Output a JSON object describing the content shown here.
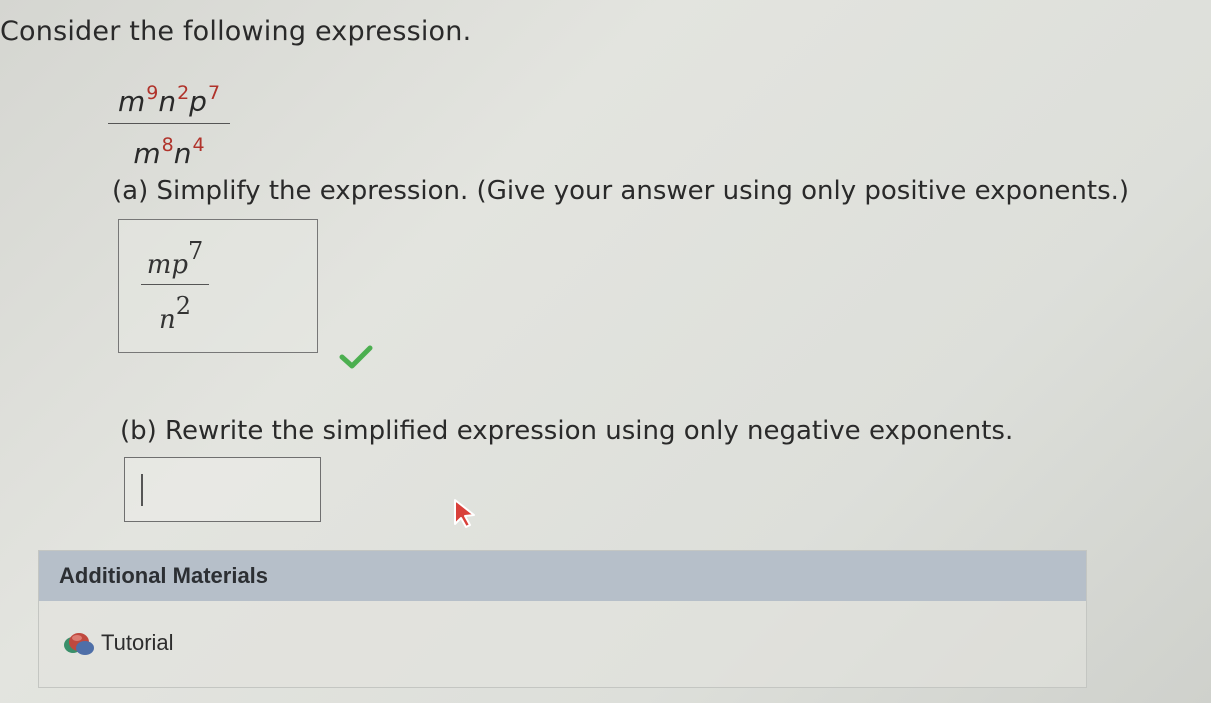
{
  "question": {
    "prompt": "Consider the following expression.",
    "expression": {
      "numerator": [
        {
          "base": "m",
          "exp": "9"
        },
        {
          "base": "n",
          "exp": "2"
        },
        {
          "base": "p",
          "exp": "7"
        }
      ],
      "denominator": [
        {
          "base": "m",
          "exp": "8"
        },
        {
          "base": "n",
          "exp": "4"
        }
      ]
    }
  },
  "part_a": {
    "instruction": "(a) Simplify the expression. (Give your answer using only positive exponents.)",
    "answer": {
      "numerator_base": "mp",
      "numerator_exp": "7",
      "denominator_base": "n",
      "denominator_exp": "2"
    },
    "status": "correct",
    "status_icon": "checkmark-icon",
    "status_color": "#4caf50"
  },
  "part_b": {
    "instruction": "(b) Rewrite the simplified expression using only negative exponents.",
    "input_value": ""
  },
  "additional_materials": {
    "header": "Additional Materials",
    "items": [
      {
        "label": "Tutorial",
        "icon": "tutorial-icon"
      }
    ]
  },
  "colors": {
    "exponent": "#b0322a",
    "materials_header_bg": "#b6bfc9"
  }
}
